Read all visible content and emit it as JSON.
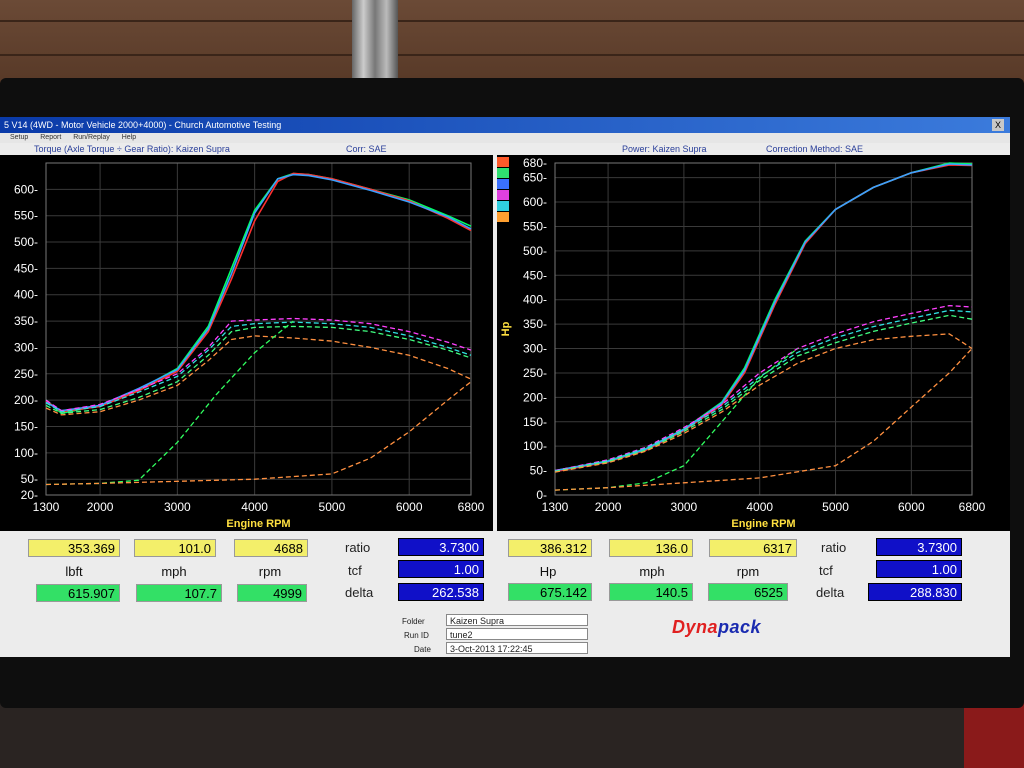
{
  "window": {
    "title": "5 V14 (4WD - Motor Vehicle 2000+4000) - Church Automotive Testing",
    "close_label": "X"
  },
  "menu": [
    "Setup",
    "Report",
    "Run/Replay",
    "Help"
  ],
  "torque_panel": {
    "header_left": "Torque (Axle Torque ÷ Gear Ratio): Kaizen Supra",
    "header_right": "Corr: SAE"
  },
  "power_panel": {
    "header_left": "Power: Kaizen Supra",
    "header_right": "Correction Method: SAE"
  },
  "chart_data": [
    {
      "type": "line",
      "xlabel": "Engine RPM",
      "x_ticks": [
        "1300",
        "2000",
        "3000",
        "4000",
        "5000",
        "6000",
        "6800"
      ],
      "y_ticks": [
        "20",
        "50",
        "100",
        "150",
        "200",
        "250",
        "300",
        "350",
        "400",
        "450",
        "500",
        "550",
        "600"
      ],
      "xlim": [
        1300,
        6800
      ],
      "ylim": [
        20,
        650
      ],
      "grid": true,
      "series": [
        {
          "color": "#00ff66",
          "x": [
            1300,
            1500,
            2000,
            2500,
            3000,
            3400,
            3700,
            4000,
            4300,
            4500,
            4700,
            5000,
            5500,
            6000,
            6500,
            6800
          ],
          "y": [
            200,
            175,
            190,
            220,
            260,
            340,
            450,
            560,
            620,
            630,
            628,
            620,
            600,
            580,
            550,
            530
          ]
        },
        {
          "color": "#ff3030",
          "x": [
            1300,
            1500,
            2000,
            2500,
            3000,
            3400,
            3700,
            4000,
            4300,
            4500,
            4700,
            5000,
            5500,
            6000,
            6500,
            6800
          ],
          "y": [
            198,
            178,
            188,
            218,
            255,
            330,
            430,
            540,
            615,
            630,
            628,
            620,
            600,
            578,
            545,
            522
          ]
        },
        {
          "color": "#3aa0ff",
          "x": [
            1300,
            1500,
            2000,
            2500,
            3000,
            3400,
            3700,
            4000,
            4300,
            4500,
            4700,
            5000,
            5500,
            6000,
            6500,
            6800
          ],
          "y": [
            196,
            180,
            190,
            222,
            258,
            335,
            440,
            555,
            620,
            628,
            626,
            618,
            598,
            576,
            548,
            525
          ]
        },
        {
          "color": "#ff40ff",
          "x": [
            1300,
            1500,
            2000,
            2500,
            3000,
            3400,
            3700,
            4000,
            4500,
            5000,
            5500,
            6000,
            6500,
            6800
          ],
          "y": [
            200,
            180,
            192,
            220,
            250,
            300,
            350,
            352,
            355,
            352,
            345,
            330,
            310,
            295
          ]
        },
        {
          "color": "#30e0e0",
          "x": [
            1300,
            1500,
            2000,
            2500,
            3000,
            3400,
            3700,
            4000,
            4500,
            5000,
            5500,
            6000,
            6500,
            6800
          ],
          "y": [
            195,
            178,
            188,
            215,
            245,
            295,
            340,
            345,
            348,
            345,
            338,
            322,
            300,
            285
          ]
        },
        {
          "color": "#40ff80",
          "x": [
            1300,
            1500,
            2000,
            2500,
            3000,
            3400,
            3700,
            4000,
            4500,
            5000,
            5500,
            6000,
            6500,
            6800
          ],
          "y": [
            190,
            175,
            182,
            205,
            235,
            285,
            330,
            338,
            340,
            338,
            330,
            315,
            295,
            280
          ]
        },
        {
          "color": "#ff9040",
          "x": [
            1300,
            1500,
            2000,
            2500,
            3000,
            3400,
            3700,
            4000,
            4500,
            5000,
            5500,
            6000,
            6500,
            6800
          ],
          "y": [
            185,
            172,
            178,
            200,
            228,
            275,
            315,
            322,
            318,
            312,
            300,
            285,
            260,
            240
          ]
        },
        {
          "color": "#30ff60",
          "x": [
            1300,
            2000,
            2500,
            3000,
            3500,
            4000,
            4500
          ],
          "y": [
            40,
            42,
            48,
            120,
            210,
            290,
            350
          ]
        },
        {
          "color": "#ff9040",
          "x": [
            1300,
            2000,
            3000,
            4000,
            5000,
            5500,
            6000,
            6500,
            6800
          ],
          "y": [
            40,
            42,
            46,
            50,
            60,
            90,
            140,
            200,
            235
          ]
        }
      ]
    },
    {
      "type": "line",
      "xlabel": "Engine RPM",
      "ylabel": "Hp",
      "x_ticks": [
        "1300",
        "2000",
        "3000",
        "4000",
        "5000",
        "6000",
        "6800"
      ],
      "y_ticks": [
        "0",
        "50",
        "100",
        "150",
        "200",
        "250",
        "300",
        "350",
        "400",
        "450",
        "500",
        "550",
        "600",
        "650",
        "680"
      ],
      "xlim": [
        1300,
        6800
      ],
      "ylim": [
        0,
        680
      ],
      "grid": true,
      "series": [
        {
          "color": "#00ff66",
          "x": [
            1300,
            2000,
            2500,
            3000,
            3500,
            3800,
            4200,
            4600,
            5000,
            5500,
            6000,
            6500,
            6800
          ],
          "y": [
            50,
            70,
            95,
            135,
            190,
            260,
            400,
            520,
            585,
            630,
            660,
            680,
            678
          ]
        },
        {
          "color": "#ff3030",
          "x": [
            1300,
            2000,
            2500,
            3000,
            3500,
            3800,
            4200,
            4600,
            5000,
            5500,
            6000,
            6500,
            6800
          ],
          "y": [
            48,
            68,
            92,
            132,
            185,
            250,
            390,
            515,
            585,
            630,
            660,
            676,
            675
          ]
        },
        {
          "color": "#3aa0ff",
          "x": [
            1300,
            2000,
            2500,
            3000,
            3500,
            3800,
            4200,
            4600,
            5000,
            5500,
            6000,
            6500,
            6800
          ],
          "y": [
            50,
            69,
            94,
            134,
            188,
            255,
            395,
            518,
            585,
            630,
            660,
            678,
            676
          ]
        },
        {
          "color": "#ff40ff",
          "x": [
            1300,
            2000,
            2500,
            3000,
            3500,
            4000,
            4500,
            5000,
            5500,
            6000,
            6500,
            6800
          ],
          "y": [
            50,
            72,
            98,
            138,
            185,
            250,
            300,
            330,
            355,
            372,
            388,
            385
          ]
        },
        {
          "color": "#30e0e0",
          "x": [
            1300,
            2000,
            2500,
            3000,
            3500,
            4000,
            4500,
            5000,
            5500,
            6000,
            6500,
            6800
          ],
          "y": [
            49,
            70,
            96,
            134,
            180,
            242,
            292,
            322,
            345,
            362,
            378,
            375
          ]
        },
        {
          "color": "#40ff80",
          "x": [
            1300,
            2000,
            2500,
            3000,
            3500,
            4000,
            4500,
            5000,
            5500,
            6000,
            6500,
            6800
          ],
          "y": [
            48,
            68,
            92,
            130,
            175,
            235,
            285,
            312,
            335,
            352,
            368,
            360
          ]
        },
        {
          "color": "#ff9040",
          "x": [
            1300,
            2000,
            2500,
            3000,
            3500,
            4000,
            4500,
            5000,
            5500,
            6000,
            6500,
            6800
          ],
          "y": [
            47,
            66,
            90,
            126,
            170,
            225,
            270,
            300,
            318,
            325,
            330,
            300
          ]
        },
        {
          "color": "#30ff60",
          "x": [
            1300,
            2000,
            2500,
            3000,
            3500,
            4000,
            4500
          ],
          "y": [
            10,
            15,
            25,
            60,
            150,
            240,
            300
          ]
        },
        {
          "color": "#ff9040",
          "x": [
            1300,
            2000,
            3000,
            4000,
            5000,
            5500,
            6000,
            6500,
            6800
          ],
          "y": [
            10,
            15,
            25,
            35,
            60,
            110,
            180,
            250,
            300
          ]
        }
      ]
    }
  ],
  "readouts": {
    "left": {
      "peak_torque": "353.369",
      "mph_1": "101.0",
      "rpm_1": "4688",
      "units_torque": "lbft",
      "units_mph": "mph",
      "units_rpm": "rpm",
      "peak_torque_2": "615.907",
      "mph_2": "107.7",
      "rpm_2": "4999",
      "ratio_label": "ratio",
      "ratio": "3.7300",
      "tcf_label": "tcf",
      "tcf": "1.00",
      "delta_label": "delta",
      "delta": "262.538"
    },
    "right": {
      "peak_power": "386.312",
      "mph_1": "136.0",
      "rpm_1": "6317",
      "units_power": "Hp",
      "units_mph": "mph",
      "units_rpm": "rpm",
      "peak_power_2": "675.142",
      "mph_2": "140.5",
      "rpm_2": "6525",
      "ratio_label": "ratio",
      "ratio": "3.7300",
      "tcf_label": "tcf",
      "tcf": "1.00",
      "delta_label": "delta",
      "delta": "288.830"
    }
  },
  "run_info": {
    "folder_label": "Folder",
    "folder": "Kaizen Supra",
    "runid_label": "Run ID",
    "runid": "tune2",
    "date_label": "Date",
    "date": "3-Oct-2013 17:22:45"
  },
  "logo": {
    "part1": "Dyna",
    "part2": "pack"
  },
  "colors": {
    "titlebar": "#0a3aa8",
    "readout_yellow": "#f3ef6a",
    "readout_green": "#33e066",
    "readout_blue": "#1010c8",
    "logo_red": "#e02020",
    "logo_blue": "#1a2bb0"
  }
}
